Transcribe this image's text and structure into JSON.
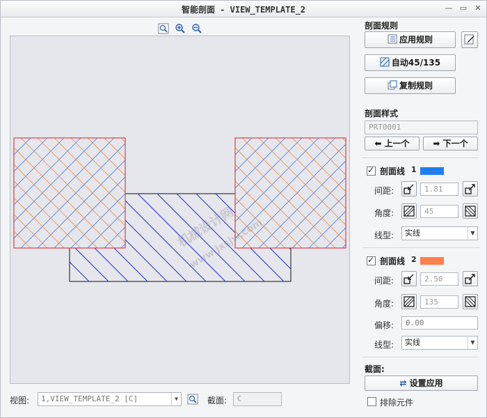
{
  "window": {
    "title": "智能剖面 - VIEW_TEMPLATE_2",
    "controls": [
      "minimize-icon",
      "maximize-icon",
      "close-icon"
    ]
  },
  "toolbar": {
    "icons": [
      "zoom-fit-icon",
      "zoom-in-icon",
      "zoom-out-icon"
    ]
  },
  "canvas": {
    "watermark_line1": "机械设计网",
    "watermark_line2": "www.jxsjw.com",
    "hatch_colors": {
      "red": "#e8322e",
      "blue": "#2b54e0",
      "orange": "#f07a3c",
      "light_blue": "#3a7ee8"
    }
  },
  "bottom": {
    "view_label": "视图:",
    "view_value": "1,VIEW_TEMPLATE_2 [C]",
    "section_label": "截面:",
    "section_value": "C"
  },
  "rules": {
    "heading": "剖面规则",
    "apply_label": "应用规则",
    "auto_label": "自动45/135",
    "copy_label": "复制规则"
  },
  "style": {
    "heading": "剖面样式",
    "part_name": "PRT0001",
    "prev_label": "上一个",
    "next_label": "下一个"
  },
  "hatch1": {
    "label": "剖面线",
    "index": "1",
    "color": "#1e7ff0",
    "spacing_label": "间距:",
    "spacing_value": "1.81",
    "angle_label": "角度:",
    "angle_value": "45",
    "linetype_label": "线型:",
    "linetype_value": "实线",
    "checked": true
  },
  "hatch2": {
    "label": "剖面线",
    "index": "2",
    "color": "#ff7f4f",
    "spacing_label": "间距:",
    "spacing_value": "2.50",
    "angle_label": "角度:",
    "angle_value": "135",
    "offset_label": "偏移:",
    "offset_value": "0.00",
    "linetype_label": "线型:",
    "linetype_value": "实线",
    "checked": true
  },
  "section": {
    "heading": "截面:",
    "set_apply_label": "设置应用",
    "exclude_label": "排除元件",
    "exclude_checked": false
  }
}
